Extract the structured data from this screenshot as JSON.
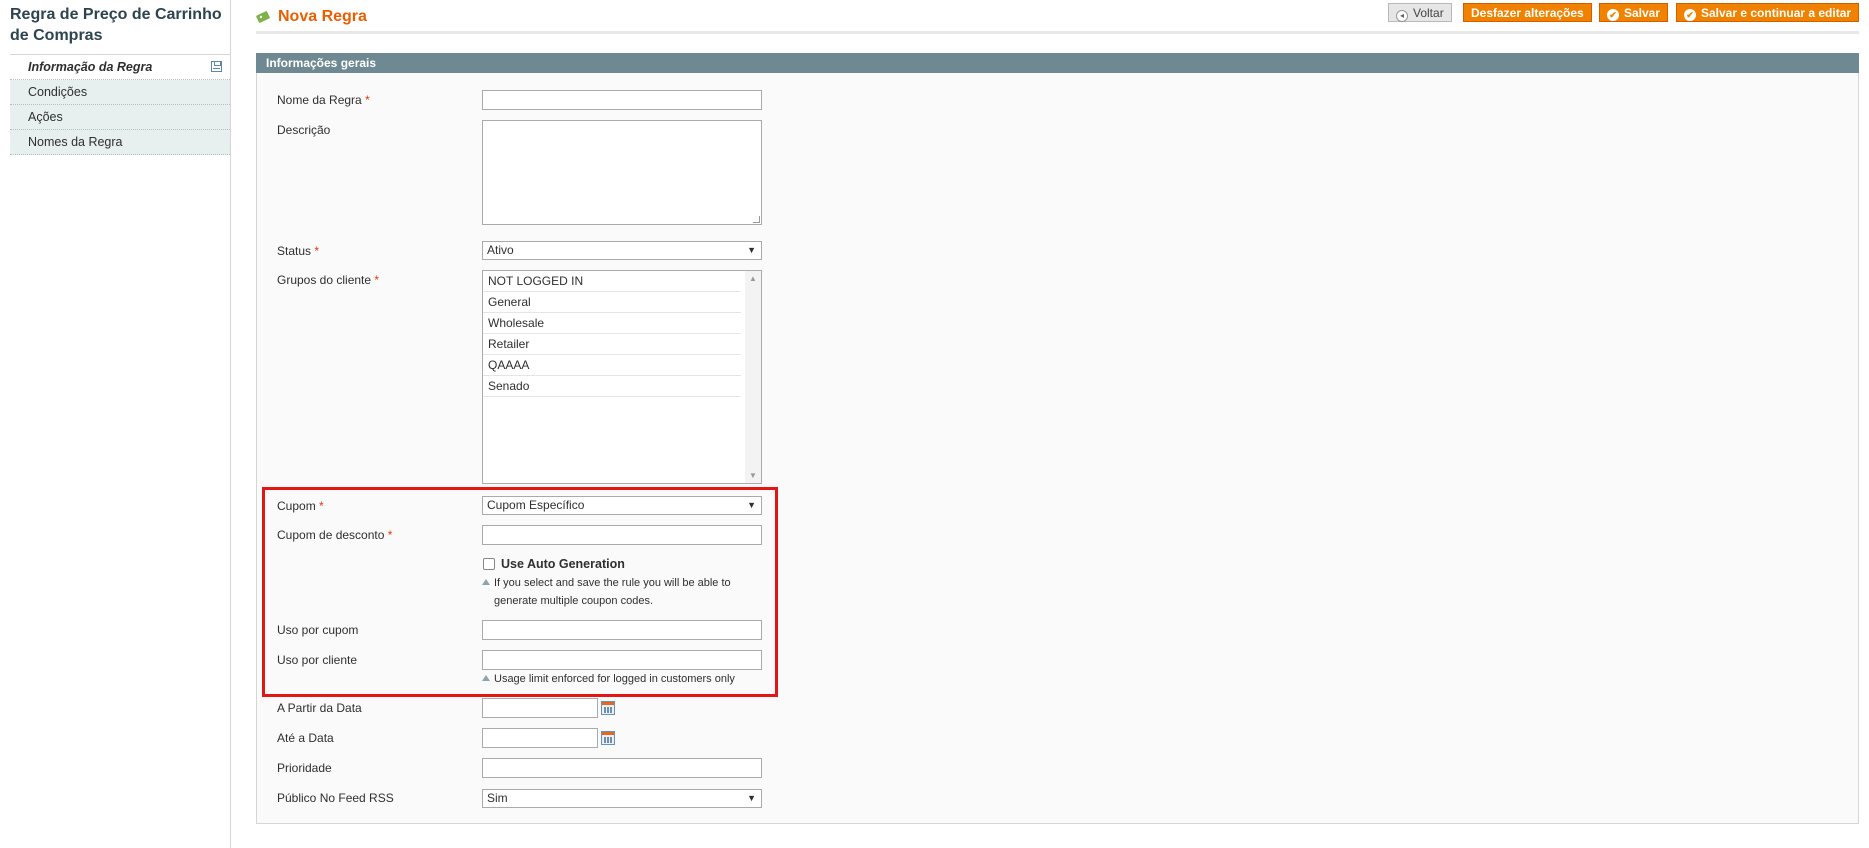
{
  "sidebar": {
    "title": "Regra de Preço de Carrinho de Compras",
    "tabs": [
      {
        "label": "Informação da Regra"
      },
      {
        "label": "Condições"
      },
      {
        "label": "Ações"
      },
      {
        "label": "Nomes da Regra"
      }
    ]
  },
  "header": {
    "title": "Nova Regra",
    "buttons": {
      "back": "Voltar",
      "reset": "Desfazer alterações",
      "save": "Salvar",
      "save_continue": "Salvar e continuar a editar"
    }
  },
  "section": {
    "title": "Informações gerais"
  },
  "form": {
    "rule_name": {
      "label": "Nome da Regra",
      "value": ""
    },
    "description": {
      "label": "Descrição",
      "value": ""
    },
    "status": {
      "label": "Status",
      "value": "Ativo"
    },
    "customer_groups": {
      "label": "Grupos do cliente",
      "options": [
        "NOT LOGGED IN",
        "General",
        "Wholesale",
        "Retailer",
        "QAAAA",
        "Senado"
      ]
    },
    "coupon": {
      "label": "Cupom",
      "value": "Cupom Específico"
    },
    "coupon_code": {
      "label": "Cupom de desconto",
      "value": ""
    },
    "auto_generation": {
      "label": "Use Auto Generation",
      "checked": false,
      "note_line1": "If you select and save the rule you will be able to",
      "note_line2": "generate multiple coupon codes."
    },
    "uses_per_coupon": {
      "label": "Uso por cupom",
      "value": ""
    },
    "uses_per_customer": {
      "label": "Uso por cliente",
      "value": "",
      "note": "Usage limit enforced for logged in customers only"
    },
    "from_date": {
      "label": "A Partir da Data",
      "value": ""
    },
    "to_date": {
      "label": "Até a Data",
      "value": ""
    },
    "priority": {
      "label": "Prioridade",
      "value": ""
    },
    "rss": {
      "label": "Público No Feed RSS",
      "value": "Sim"
    }
  },
  "colors": {
    "accent": "#eb5e00",
    "button": "#f18200",
    "section_header": "#6f8992",
    "highlight": "#e31515"
  }
}
